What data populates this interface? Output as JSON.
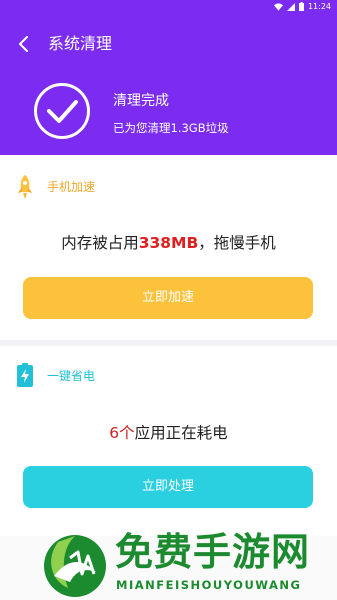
{
  "status_bar": {
    "time": "11:24"
  },
  "header": {
    "title": "系统清理",
    "result_title": "清理完成",
    "result_desc": "已为您清理1.3GB垃圾"
  },
  "speedup": {
    "label": "手机加速",
    "msg_before": "内存被占用",
    "msg_value": "338MB",
    "msg_after": "，拖慢手机",
    "button": "立即加速"
  },
  "power_save": {
    "label": "一键省电",
    "msg_value": "6个",
    "msg_after": "应用正在耗电",
    "button": "立即处理"
  },
  "watermark": {
    "title": "免费手游网",
    "subtitle": "MIANFEISHOUYOUWANG"
  },
  "colors": {
    "header_bg": "#7b2cf0",
    "speedup_accent": "#f0a82b",
    "speedup_button": "#fcc23c",
    "power_accent": "#22c0d6",
    "power_button": "#2bd0e0",
    "highlight": "#e02020"
  }
}
